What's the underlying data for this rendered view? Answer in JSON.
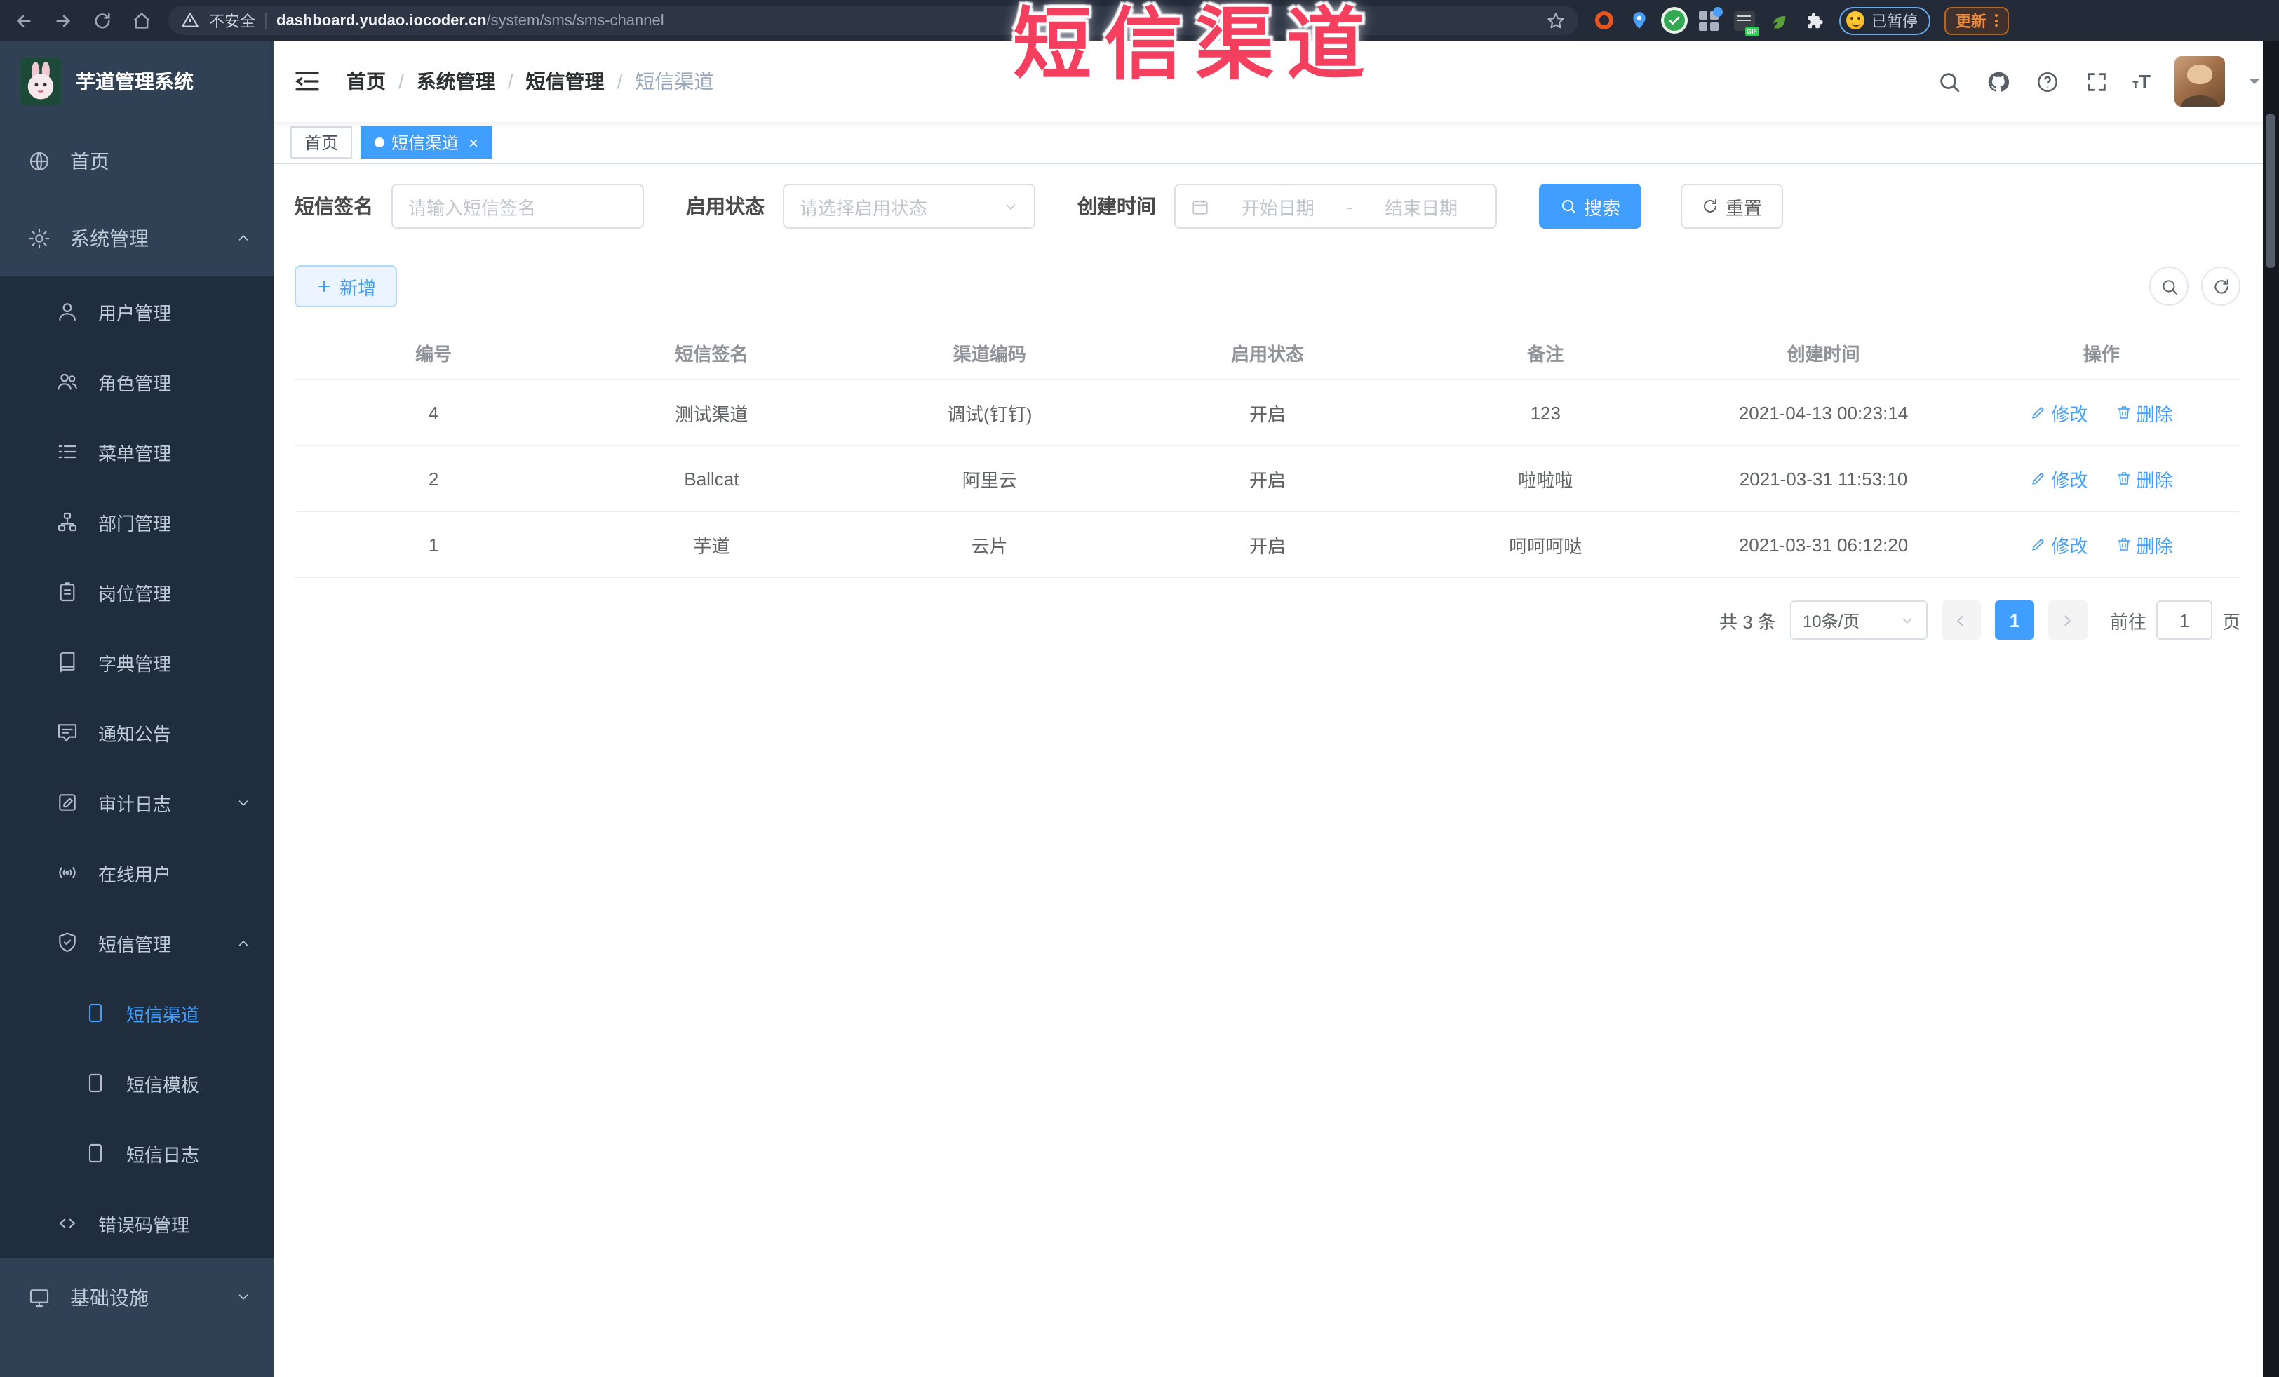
{
  "browser": {
    "security_label": "不安全",
    "url_domain": "dashboard.yudao.iocoder.cn",
    "url_path": "/system/sms/sms-channel",
    "paused_label": "已暂停",
    "update_label": "更新"
  },
  "annotation": {
    "text": "短信渠道",
    "color": "#f43f5e"
  },
  "sidebar": {
    "logo_title": "芋道管理系统",
    "items": [
      {
        "label": "首页"
      },
      {
        "label": "系统管理"
      },
      {
        "label": "用户管理"
      },
      {
        "label": "角色管理"
      },
      {
        "label": "菜单管理"
      },
      {
        "label": "部门管理"
      },
      {
        "label": "岗位管理"
      },
      {
        "label": "字典管理"
      },
      {
        "label": "通知公告"
      },
      {
        "label": "审计日志"
      },
      {
        "label": "在线用户"
      },
      {
        "label": "短信管理"
      },
      {
        "label": "短信渠道",
        "active": true
      },
      {
        "label": "短信模板"
      },
      {
        "label": "短信日志"
      },
      {
        "label": "错误码管理"
      },
      {
        "label": "基础设施"
      }
    ]
  },
  "header": {
    "breadcrumbs": [
      "首页",
      "系统管理",
      "短信管理",
      "短信渠道"
    ]
  },
  "tags": [
    {
      "label": "首页"
    },
    {
      "label": "短信渠道"
    }
  ],
  "filters": {
    "sign_label": "短信签名",
    "sign_placeholder": "请输入短信签名",
    "status_label": "启用状态",
    "status_placeholder": "请选择启用状态",
    "time_label": "创建时间",
    "start_placeholder": "开始日期",
    "range_separator": "-",
    "end_placeholder": "结束日期",
    "search_label": "搜索",
    "reset_label": "重置"
  },
  "toolbar": {
    "add_label": "新增"
  },
  "table": {
    "columns": [
      "编号",
      "短信签名",
      "渠道编码",
      "启用状态",
      "备注",
      "创建时间",
      "操作"
    ],
    "edit_label": "修改",
    "delete_label": "删除",
    "rows": [
      {
        "id": "4",
        "sign": "测试渠道",
        "code": "调试(钉钉)",
        "status": "开启",
        "remark": "123",
        "created": "2021-04-13 00:23:14"
      },
      {
        "id": "2",
        "sign": "Ballcat",
        "code": "阿里云",
        "status": "开启",
        "remark": "啦啦啦",
        "created": "2021-03-31 11:53:10"
      },
      {
        "id": "1",
        "sign": "芋道",
        "code": "云片",
        "status": "开启",
        "remark": "呵呵呵哒",
        "created": "2021-03-31 06:12:20"
      }
    ]
  },
  "pagination": {
    "total_label": "共 3 条",
    "page_size_label": "10条/页",
    "current_page": "1",
    "goto_label": "前往",
    "goto_value": "1",
    "page_unit_label": "页"
  },
  "colors": {
    "accent": "#409eff",
    "sidebar_bg": "#304156",
    "submenu_bg": "#1f2d3d",
    "annotation": "#f43f5e"
  }
}
